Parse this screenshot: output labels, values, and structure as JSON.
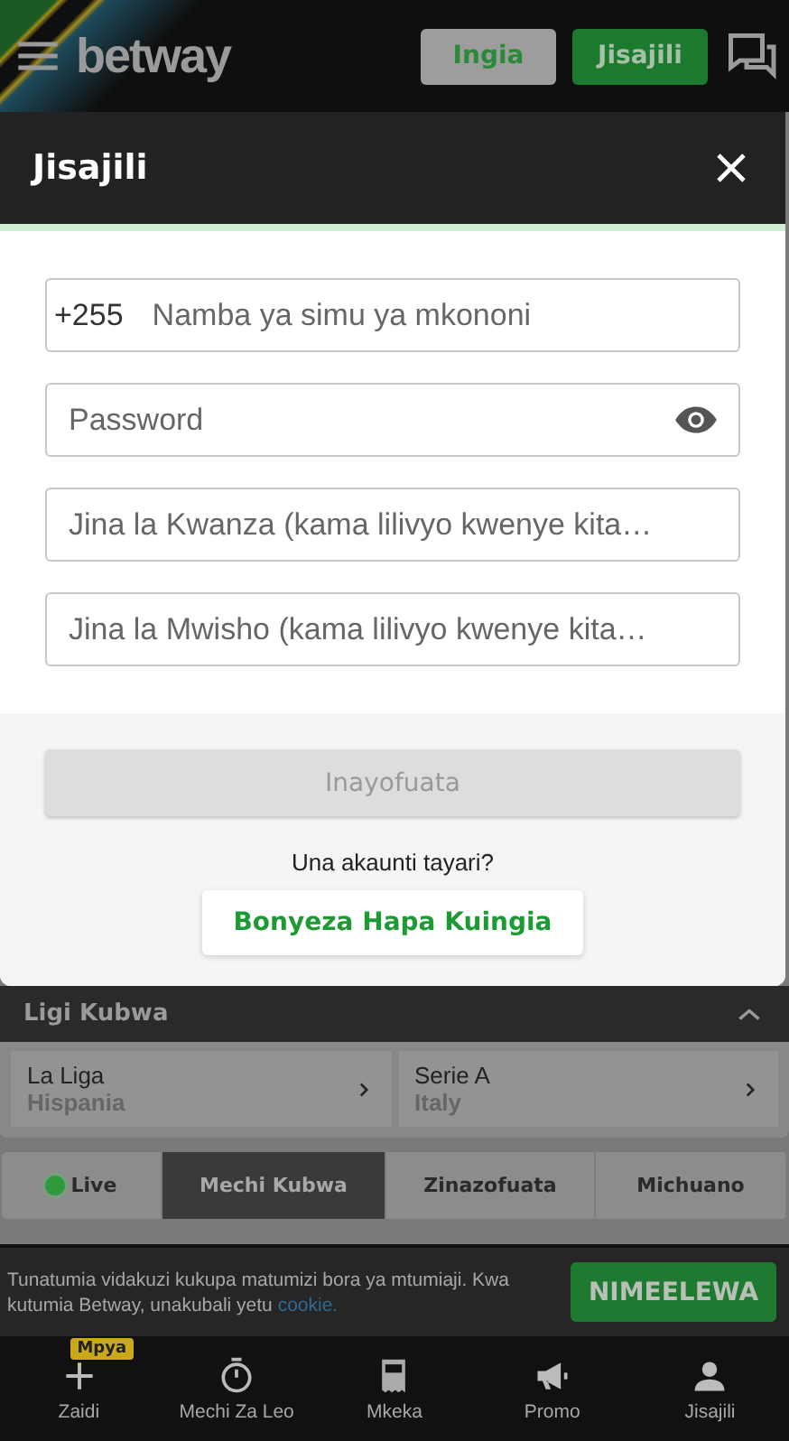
{
  "header": {
    "logo": "betway",
    "buttons": [
      {
        "label": "Ingia",
        "kind": "login"
      },
      {
        "label": "Jisajili",
        "kind": "register"
      }
    ]
  },
  "modal": {
    "title": "Jisajili",
    "fields": [
      {
        "kind": "phone",
        "prefix": "+255",
        "placeholder": "Namba ya simu ya mkononi"
      },
      {
        "kind": "password",
        "placeholder": "Password"
      },
      {
        "kind": "text",
        "placeholder": "Jina la Kwanza (kama lilivyo kwenye kita…"
      },
      {
        "kind": "text",
        "placeholder": "Jina la Mwisho (kama lilivyo kwenye kita…"
      }
    ],
    "submit": {
      "label": "Inayofuata",
      "disabled": true
    },
    "login_prompt": "Una akaunti tayari?",
    "login_link": "Bonyeza Hapa Kuingia"
  },
  "section": {
    "title": "Ligi Kubwa",
    "expanded": true,
    "leagues": [
      {
        "name": "La Liga",
        "country": "Hispania"
      },
      {
        "name": "Serie A",
        "country": "Italy"
      }
    ]
  },
  "tabs": [
    {
      "label": "Live",
      "kind": "live",
      "selected": false
    },
    {
      "label": "Mechi Kubwa",
      "kind": "plain",
      "selected": true
    },
    {
      "label": "Zinazofuata",
      "kind": "plain",
      "selected": false
    },
    {
      "label": "Michuano",
      "kind": "plain",
      "selected": false
    }
  ],
  "cookie_banner": {
    "text": "Tunatumia vidakuzi kukupa matumizi bora ya mtumiaji. Kwa kutumia Betway, unakubali yetu ",
    "link": "cookie.",
    "button": "NIMEELEWA"
  },
  "bottom_nav": [
    {
      "label": "Zaidi",
      "kind": "plus",
      "badge": "Mpya"
    },
    {
      "label": "Mechi Za Leo",
      "kind": "stopwatch"
    },
    {
      "label": "Mkeka",
      "kind": "slip"
    },
    {
      "label": "Promo",
      "kind": "megaphone"
    },
    {
      "label": "Jisajili",
      "kind": "person"
    }
  ]
}
